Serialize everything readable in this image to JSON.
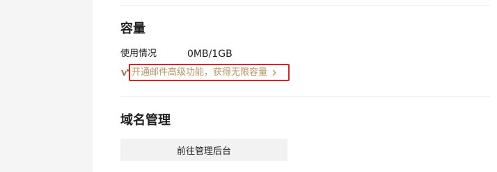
{
  "capacity": {
    "title": "容量",
    "usage_label": "使用情况",
    "usage_value": "0MB/1GB",
    "upgrade_link": "开通邮件高级功能，获得无限容量",
    "upgrade_icon": "vip-crown-icon",
    "chevron_icon": "chevron-right-icon",
    "accent_color": "#b99764",
    "highlight_color": "#e02020"
  },
  "domain": {
    "title": "域名管理",
    "admin_button_label": "前往管理后台"
  }
}
